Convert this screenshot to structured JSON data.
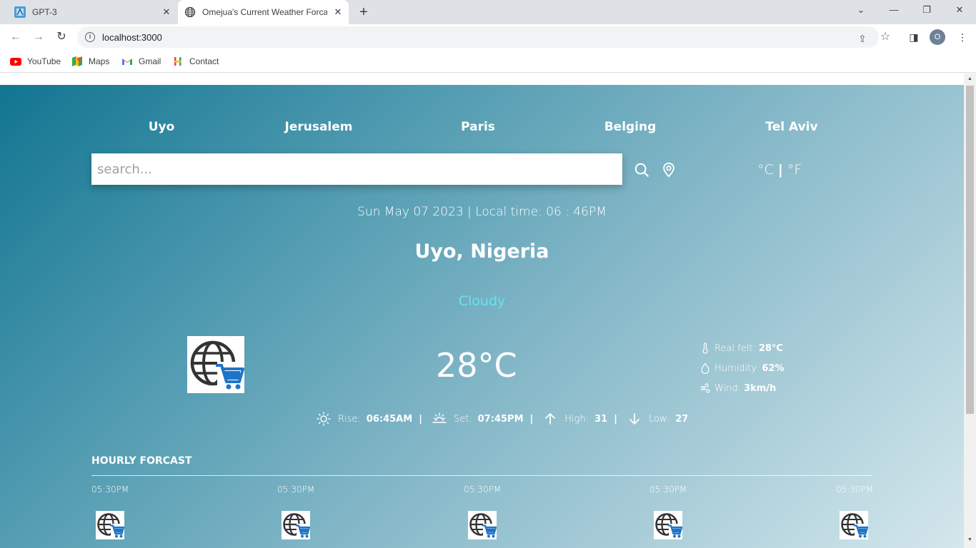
{
  "browser": {
    "tabs": [
      {
        "title": "GPT-3",
        "active": false
      },
      {
        "title": "Omejua's Current Weather Forcast",
        "active": true
      }
    ],
    "url": "localhost:3000",
    "profile_initial": "O",
    "bookmarks": [
      "YouTube",
      "Maps",
      "Gmail",
      "Contact"
    ]
  },
  "app": {
    "cities": [
      "Uyo",
      "Jerusalem",
      "Paris",
      "Belging",
      "Tel Aviv"
    ],
    "search_placeholder": "search...",
    "units": {
      "celsius": "°C",
      "separator": "|",
      "fahrenheit": "°F"
    },
    "datetime": "Sun May 07 2023 | Local time: 06 : 46PM",
    "location": "Uyo, Nigeria",
    "condition": "Cloudy",
    "temperature": "28°C",
    "details": [
      {
        "label": "Real felt:",
        "value": "28°C",
        "icon": "thermometer-icon"
      },
      {
        "label": "Humidity:",
        "value": "62%",
        "icon": "droplet-icon"
      },
      {
        "label": "Wind:",
        "value": "3km/h",
        "icon": "wind-icon"
      }
    ],
    "sun": {
      "rise_label": "Rise:",
      "rise_value": "06:45AM",
      "set_label": "Set:",
      "set_value": "07:45PM",
      "high_label": "High:",
      "high_value": "31",
      "low_label": "Low:",
      "low_value": "27",
      "separator": "|"
    },
    "hourly_title": "HOURLY FORCAST",
    "hourly": [
      {
        "time": "05:30PM"
      },
      {
        "time": "05:30PM"
      },
      {
        "time": "05:30PM"
      },
      {
        "time": "05:30PM"
      },
      {
        "time": "05:30PM"
      }
    ],
    "colors": {
      "condition": "#67e3f0",
      "gradient_start": "#127591",
      "gradient_end": "#d4e7ec"
    }
  }
}
